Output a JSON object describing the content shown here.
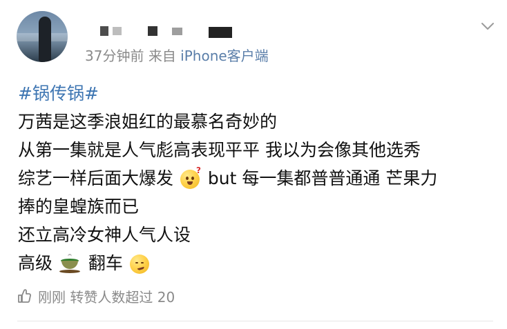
{
  "header": {
    "time_ago": "37分钟前",
    "source_prefix": "来自",
    "source_name": "iPhone客户端"
  },
  "post": {
    "topic": "#锅传锅#",
    "line_1": "万茜是这季浪姐红的最慕名奇妙的",
    "line_2": "从第一集就是人气彪高表现平平 我以为会像其他选秀",
    "line_3_before": "综艺一样后面大爆发 ",
    "line_3_after": "but 每一集都普普通通 芒果力",
    "line_4": "捧的皇蝗族而已",
    "line_5": "还立高冷女神人气人设",
    "line_6_before": "高级",
    "line_6_middle": "翻车 "
  },
  "icons": {
    "avatar": "avatar-image",
    "chevron": "chevron-down-icon",
    "like": "thumbs-up-icon",
    "question_emoji": "surprised-face-emoji",
    "tea_emoji": "tea-cup-emoji",
    "smirk_emoji": "smirking-face-emoji"
  },
  "footer": {
    "status_text": "刚刚 转赞人数超过 20"
  },
  "colors": {
    "topic": "#3d75b2",
    "source": "#5a7ea9",
    "meta": "#8a8a8a",
    "text": "#111111"
  }
}
